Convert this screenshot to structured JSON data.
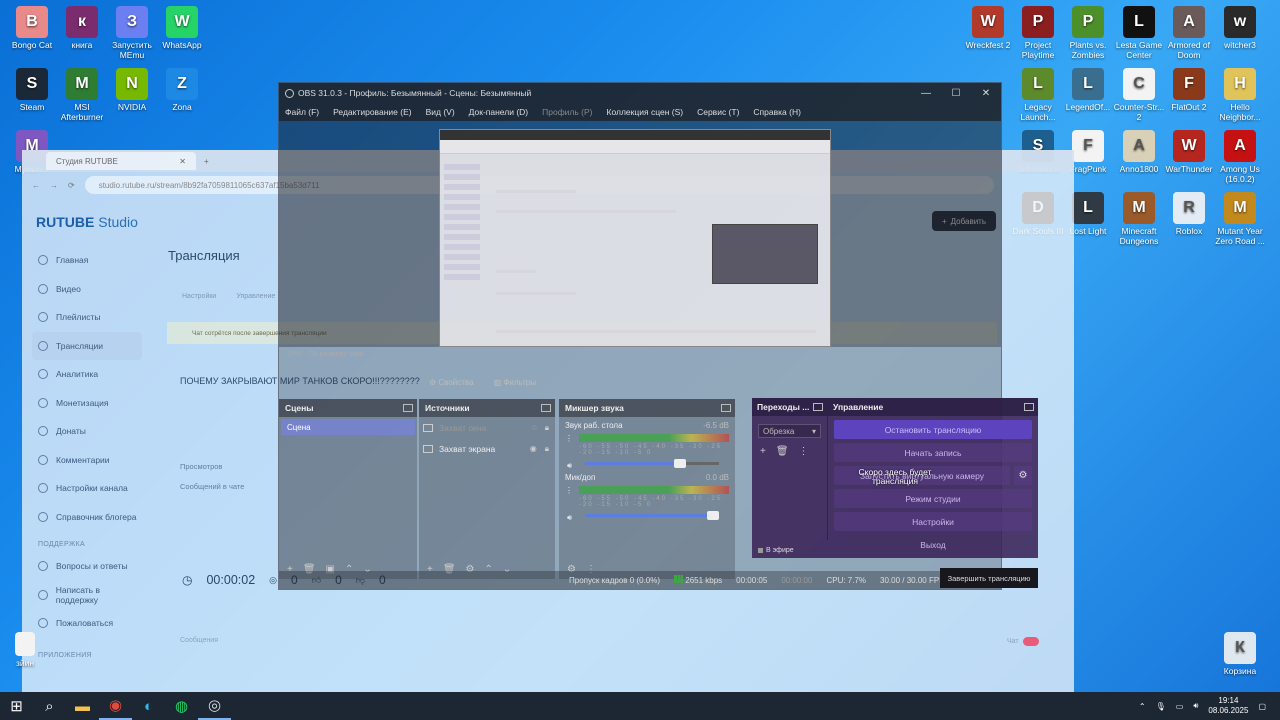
{
  "desktop": {
    "left_icons": [
      {
        "label": "Bongo Cat",
        "icon": "bongo-cat-icon",
        "color": "#e98a8a"
      },
      {
        "label": "книга",
        "icon": "winrar-icon",
        "color": "#7b2c6e"
      },
      {
        "label": "Запустить MEmu",
        "icon": "memu-icon",
        "color": "#6c7ff0"
      },
      {
        "label": "WhatsApp",
        "icon": "whatsapp-icon",
        "color": "#25d366"
      },
      {
        "label": "Steam",
        "icon": "steam-icon",
        "color": "#1b2838"
      },
      {
        "label": "MSI Afterburner",
        "icon": "msi-afterburner-icon",
        "color": "#2e7d32"
      },
      {
        "label": "NVIDIA",
        "icon": "nvidia-icon",
        "color": "#76b900"
      },
      {
        "label": "Zona",
        "icon": "zona-icon",
        "color": "#1e88e5"
      },
      {
        "label": "Мумыч...",
        "icon": "folder-icon",
        "color": "#7e57c2"
      }
    ],
    "right_icons": [
      {
        "label": "Wreckfest 2",
        "icon": "wreckfest-icon",
        "color": "#b23a2a"
      },
      {
        "label": "Project Playtime",
        "icon": "project-playtime-icon",
        "color": "#8b1e1e"
      },
      {
        "label": "Plants vs. Zombies",
        "icon": "pvz-icon",
        "color": "#4c8f2b"
      },
      {
        "label": "Lesta Game Center",
        "icon": "lesta-icon",
        "color": "#111111"
      },
      {
        "label": "Armored of Doom",
        "icon": "armored-icon",
        "color": "#6a5a5a"
      },
      {
        "label": "witcher3",
        "icon": "witcher3-icon",
        "color": "#2a2a2a"
      },
      {
        "label": "Legacy Launch...",
        "icon": "legacy-launcher-icon",
        "color": "#5d8a2a"
      },
      {
        "label": "LegendOf...",
        "icon": "legendof-icon",
        "color": "#3a6e8f"
      },
      {
        "label": "Counter-Str... 2",
        "icon": "cs2-file-icon",
        "color": "#f3f3f3"
      },
      {
        "label": "FlatOut 2",
        "icon": "flatout-icon",
        "color": "#8a3a1a"
      },
      {
        "label": "Hello Neighbor...",
        "icon": "hello-neighbor-icon",
        "color": "#e0c35a"
      },
      {
        "label": "Subnautica",
        "icon": "subnautica-icon",
        "color": "#1d5f8f"
      },
      {
        "label": "FragPunk",
        "icon": "fragpunk-file-icon",
        "color": "#f3f3f3"
      },
      {
        "label": "Anno1800",
        "icon": "anno-icon",
        "color": "#d9d0b8"
      },
      {
        "label": "WarThunder",
        "icon": "warthunder-icon",
        "color": "#b5261e"
      },
      {
        "label": "Among Us (16.0.2)",
        "icon": "among-us-icon",
        "color": "#c51111"
      },
      {
        "label": "Dark Souls III",
        "icon": "dark-souls-icon",
        "color": "#4a3a2a"
      },
      {
        "label": "Lost Light",
        "icon": "lost-light-icon",
        "color": "#2f3a44"
      },
      {
        "label": "Minecraft Dungeons",
        "icon": "minecraft-dungeons-icon",
        "color": "#9a5a2a"
      },
      {
        "label": "Roblox",
        "icon": "roblox-icon",
        "color": "#e3ecf5"
      },
      {
        "label": "Mutant Year Zero Road ...",
        "icon": "mutant-icon",
        "color": "#c28a1e"
      },
      {
        "label": "Корзина",
        "icon": "recycle-bin-icon",
        "color": "#dfe7ef"
      }
    ],
    "bottom_left_label": "зйин"
  },
  "browser": {
    "tab_title": "Студия RUTUBE",
    "url": "studio.rutube.ru/stream/8b92fa7059811065c637af15ba53d711",
    "brand": "RUTUBE",
    "brand_suffix": "Studio",
    "add_button": "Добавить",
    "nav": [
      {
        "label": "Главная",
        "active": false
      },
      {
        "label": "Видео",
        "active": false
      },
      {
        "label": "Плейлисты",
        "active": false
      },
      {
        "label": "Трансляции",
        "active": true
      },
      {
        "label": "Аналитика",
        "active": false
      },
      {
        "label": "Монетизация",
        "active": false
      },
      {
        "label": "Донаты",
        "active": false
      },
      {
        "label": "Комментарии",
        "active": false
      },
      {
        "label": "Настройки канала",
        "active": false
      },
      {
        "label": "Справочник блогера",
        "active": false
      }
    ],
    "support_section": "ПОДДЕРЖКА",
    "support_nav": [
      "Вопросы и ответы",
      "Написать в поддержку",
      "Пожаловаться"
    ],
    "apps_section": "ПРИЛОЖЕНИЯ",
    "page_title": "Трансляция",
    "tabs": [
      "Настройки",
      "Управление"
    ],
    "warning": "Чат сотрётся после завершения трансляции",
    "stream_name": "ПОЧЕМУ ЗАКРЫВАЮТ МИР ТАНКОВ СКОРО!!!????????",
    "stats": [
      "Просмотров",
      "Сообщений в чате"
    ],
    "timer": "00:00:02",
    "viewers": "0",
    "likes": "0",
    "dislikes": "0",
    "messages_label": "Сообщения",
    "chat_label": "Чат"
  },
  "obs": {
    "title": "OBS 31.0.3 - Профиль: Безымянный - Сцены: Безымянный",
    "menu": [
      {
        "label": "Файл (F)",
        "disabled": false
      },
      {
        "label": "Редактирование (E)",
        "disabled": false
      },
      {
        "label": "Вид (V)",
        "disabled": false
      },
      {
        "label": "Док-панели (D)",
        "disabled": false
      },
      {
        "label": "Профиль (P)",
        "disabled": true
      },
      {
        "label": "Коллекция сцен (S)",
        "disabled": false
      },
      {
        "label": "Сервис (T)",
        "disabled": false
      },
      {
        "label": "Справка (H)",
        "disabled": false
      }
    ],
    "zoom_label": "35%",
    "zoom_mode": "По размеру окна",
    "properties": "Свойства",
    "filters": "Фильтры",
    "scenes_header": "Сцены",
    "scenes": [
      "Сцена"
    ],
    "sources_header": "Источники",
    "sources": [
      {
        "label": "Захват окна",
        "dim": true
      },
      {
        "label": "Захват экрана",
        "dim": false
      }
    ],
    "mixer_header": "Микшер звука",
    "mixer": [
      {
        "label": "Звук раб. стола",
        "db": "-6.5 dB",
        "scale": "-60 -55 -50 -45 -40 -35 -30 -25 -20 -15 -10 -5 0",
        "level": 0.75
      },
      {
        "label": "Мик/доп",
        "db": "0.0 dB",
        "scale": "-60 -55 -50 -45 -40 -35 -30 -25 -20 -15 -10 -5 0",
        "level": 1.0
      }
    ],
    "transitions_header": "Переходы ...",
    "transition_select": "Обрезка",
    "on_air": "В эфире",
    "controls_header": "Управление",
    "controls": {
      "stop_stream": "Остановить трансляцию",
      "start_record": "Начать запись",
      "virtual_cam": "Запустить виртуальную камеру",
      "studio_mode": "Режим студии",
      "settings": "Настройки",
      "exit": "Выход"
    },
    "tooltip": "Скоро здесь будет трансляция",
    "end_stream": "Завершить трансляцию",
    "status": {
      "dropped": "Пропуск кадров 0 (0.0%)",
      "bitrate": "2651 kbps",
      "stream_time": "00:00:05",
      "rec_time": "00:00:00",
      "cpu": "CPU: 7.7%",
      "fps": "30.00 / 30.00 FPS"
    }
  },
  "taskbar": {
    "time": "19:14",
    "date": "08.06.2025",
    "apps": [
      "start-icon",
      "search-icon",
      "explorer-icon",
      "chrome-icon",
      "edge-icon",
      "whatsapp-icon",
      "obs-icon"
    ]
  }
}
